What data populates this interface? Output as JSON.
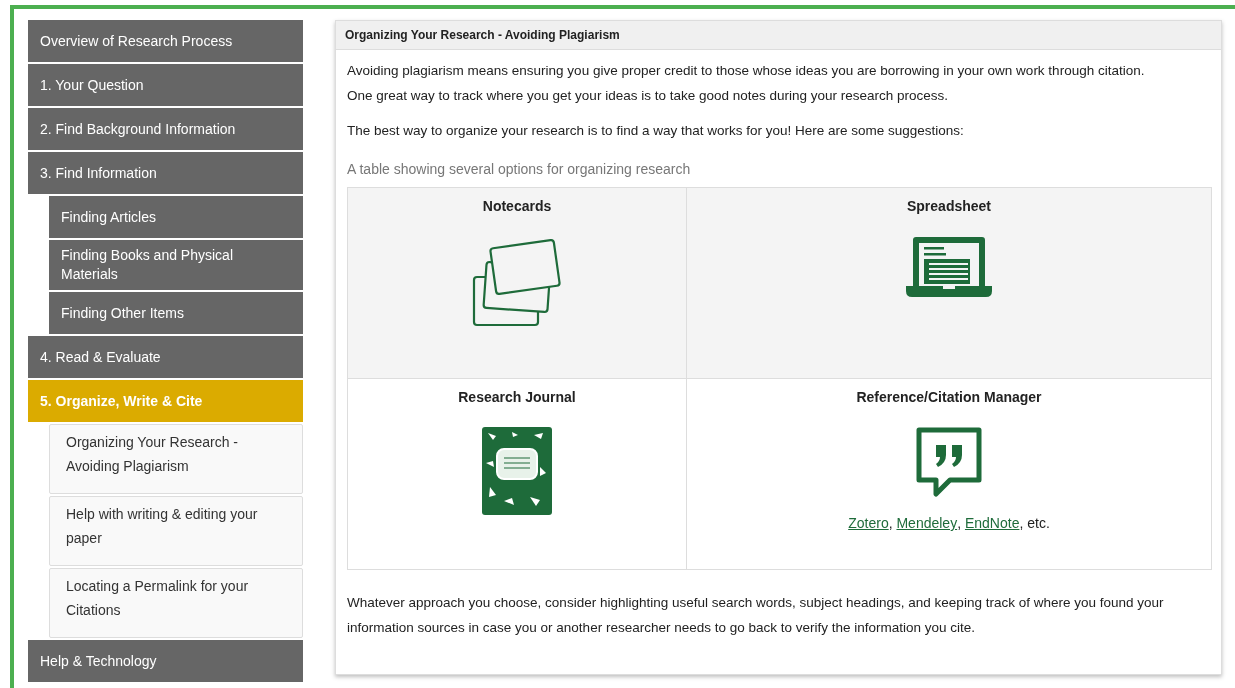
{
  "sidebar": {
    "items": [
      {
        "label": "Overview of Research Process",
        "selected": false
      },
      {
        "label": "1. Your Question",
        "selected": false
      },
      {
        "label": "2. Find Background Information",
        "selected": false
      },
      {
        "label": "3. Find Information",
        "selected": false,
        "children": [
          {
            "label": "Finding Articles",
            "selected": false
          },
          {
            "label": "Finding Books and Physical Materials",
            "selected": false
          },
          {
            "label": "Finding Other Items",
            "selected": false
          }
        ]
      },
      {
        "label": "4. Read & Evaluate",
        "selected": false
      },
      {
        "label": "5. Organize, Write & Cite",
        "selected": true,
        "children": [
          {
            "label": "Organizing Your Research - Avoiding Plagiarism",
            "selected": false
          },
          {
            "label": "Help with writing & editing your paper",
            "selected": false
          },
          {
            "label": "Locating a Permalink for your Citations",
            "selected": false
          }
        ]
      },
      {
        "label": "Help & Technology",
        "selected": false
      }
    ]
  },
  "panel": {
    "title": "Organizing Your Research - Avoiding Plagiarism",
    "paragraphs": [
      "Avoiding plagiarism means ensuring you give proper credit to those whose ideas you are borrowing in your own work through citation. One great way to track where you get your ideas is to take good notes during your research process.",
      "The best way to organize your research is to find a way that works for you! Here are some suggestions:"
    ],
    "table": {
      "caption": "A table showing several options for organizing research",
      "rows": [
        {
          "cells": [
            {
              "heading": "Notecards"
            },
            {
              "heading": "Spreadsheet"
            }
          ]
        },
        {
          "cells": [
            {
              "heading": "Research Journal"
            },
            {
              "heading": "Reference/Citation Manager",
              "note": [
                {
                  "kind": "link",
                  "text": "Zotero"
                },
                {
                  "kind": "plain",
                  "text": ", "
                },
                {
                  "kind": "link",
                  "text": "Mendeley"
                },
                {
                  "kind": "plain",
                  "text": ", "
                },
                {
                  "kind": "link",
                  "text": "EndNote"
                },
                {
                  "kind": "plain",
                  "text": ", etc."
                }
              ]
            }
          ]
        }
      ]
    },
    "closing": "Whatever approach you choose, consider highlighting useful search words, subject headings, and keeping track of where you found your information sources in case you or another researcher needs to go back to verify the information you cite."
  }
}
